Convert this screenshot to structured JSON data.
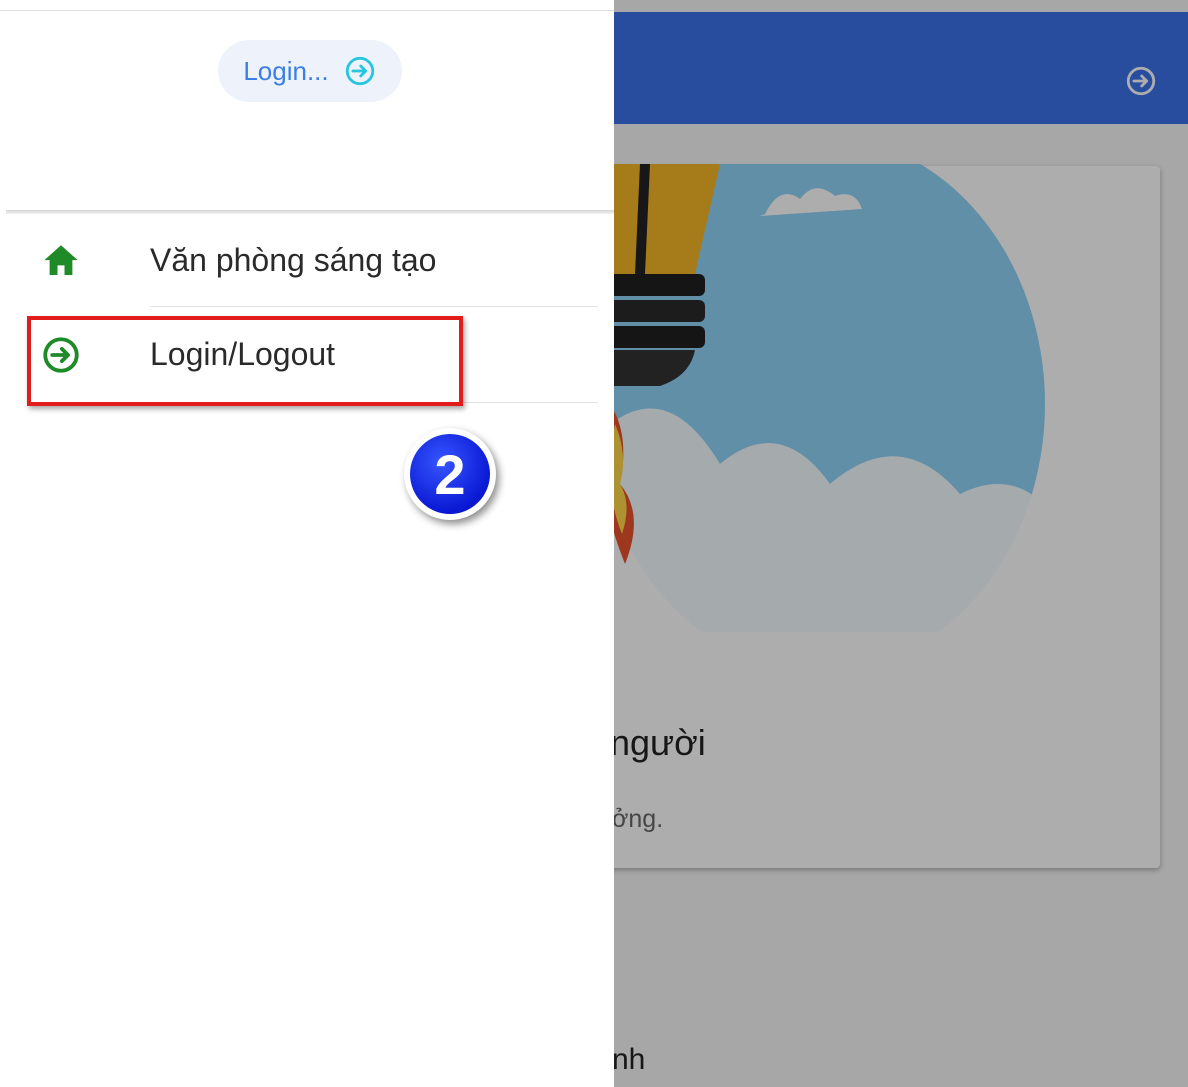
{
  "colors": {
    "header": "#3c72ea",
    "accent_green": "#1e8a28",
    "login_blue": "#3c7ee6",
    "highlight_red": "#e21b1b",
    "badge_blue": "#0a19d4"
  },
  "header": {
    "login_icon": "login-circle-arrow-icon"
  },
  "drawer": {
    "login_chip": {
      "label": "Login...",
      "icon": "login-circle-arrow-icon"
    },
    "items": [
      {
        "label": "Văn phòng sáng tạo",
        "icon": "home-icon"
      },
      {
        "label": "Login/Logout",
        "icon": "login-circle-arrow-icon"
      }
    ]
  },
  "background_card": {
    "title_fragment": "người",
    "subtitle_fragment": "ởng."
  },
  "background_bottom": {
    "text_fragment": "nh"
  },
  "annotation": {
    "step_number": "2"
  }
}
